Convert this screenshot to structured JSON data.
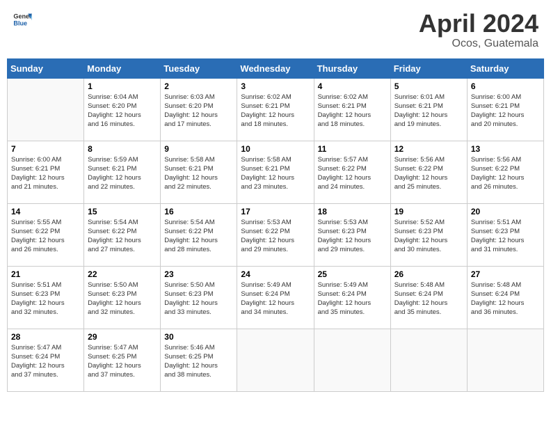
{
  "header": {
    "logo_general": "General",
    "logo_blue": "Blue",
    "month": "April 2024",
    "location": "Ocos, Guatemala"
  },
  "columns": [
    "Sunday",
    "Monday",
    "Tuesday",
    "Wednesday",
    "Thursday",
    "Friday",
    "Saturday"
  ],
  "weeks": [
    [
      {
        "day": "",
        "info": ""
      },
      {
        "day": "1",
        "info": "Sunrise: 6:04 AM\nSunset: 6:20 PM\nDaylight: 12 hours\nand 16 minutes."
      },
      {
        "day": "2",
        "info": "Sunrise: 6:03 AM\nSunset: 6:20 PM\nDaylight: 12 hours\nand 17 minutes."
      },
      {
        "day": "3",
        "info": "Sunrise: 6:02 AM\nSunset: 6:21 PM\nDaylight: 12 hours\nand 18 minutes."
      },
      {
        "day": "4",
        "info": "Sunrise: 6:02 AM\nSunset: 6:21 PM\nDaylight: 12 hours\nand 18 minutes."
      },
      {
        "day": "5",
        "info": "Sunrise: 6:01 AM\nSunset: 6:21 PM\nDaylight: 12 hours\nand 19 minutes."
      },
      {
        "day": "6",
        "info": "Sunrise: 6:00 AM\nSunset: 6:21 PM\nDaylight: 12 hours\nand 20 minutes."
      }
    ],
    [
      {
        "day": "7",
        "info": "Sunrise: 6:00 AM\nSunset: 6:21 PM\nDaylight: 12 hours\nand 21 minutes."
      },
      {
        "day": "8",
        "info": "Sunrise: 5:59 AM\nSunset: 6:21 PM\nDaylight: 12 hours\nand 22 minutes."
      },
      {
        "day": "9",
        "info": "Sunrise: 5:58 AM\nSunset: 6:21 PM\nDaylight: 12 hours\nand 22 minutes."
      },
      {
        "day": "10",
        "info": "Sunrise: 5:58 AM\nSunset: 6:21 PM\nDaylight: 12 hours\nand 23 minutes."
      },
      {
        "day": "11",
        "info": "Sunrise: 5:57 AM\nSunset: 6:22 PM\nDaylight: 12 hours\nand 24 minutes."
      },
      {
        "day": "12",
        "info": "Sunrise: 5:56 AM\nSunset: 6:22 PM\nDaylight: 12 hours\nand 25 minutes."
      },
      {
        "day": "13",
        "info": "Sunrise: 5:56 AM\nSunset: 6:22 PM\nDaylight: 12 hours\nand 26 minutes."
      }
    ],
    [
      {
        "day": "14",
        "info": "Sunrise: 5:55 AM\nSunset: 6:22 PM\nDaylight: 12 hours\nand 26 minutes."
      },
      {
        "day": "15",
        "info": "Sunrise: 5:54 AM\nSunset: 6:22 PM\nDaylight: 12 hours\nand 27 minutes."
      },
      {
        "day": "16",
        "info": "Sunrise: 5:54 AM\nSunset: 6:22 PM\nDaylight: 12 hours\nand 28 minutes."
      },
      {
        "day": "17",
        "info": "Sunrise: 5:53 AM\nSunset: 6:22 PM\nDaylight: 12 hours\nand 29 minutes."
      },
      {
        "day": "18",
        "info": "Sunrise: 5:53 AM\nSunset: 6:23 PM\nDaylight: 12 hours\nand 29 minutes."
      },
      {
        "day": "19",
        "info": "Sunrise: 5:52 AM\nSunset: 6:23 PM\nDaylight: 12 hours\nand 30 minutes."
      },
      {
        "day": "20",
        "info": "Sunrise: 5:51 AM\nSunset: 6:23 PM\nDaylight: 12 hours\nand 31 minutes."
      }
    ],
    [
      {
        "day": "21",
        "info": "Sunrise: 5:51 AM\nSunset: 6:23 PM\nDaylight: 12 hours\nand 32 minutes."
      },
      {
        "day": "22",
        "info": "Sunrise: 5:50 AM\nSunset: 6:23 PM\nDaylight: 12 hours\nand 32 minutes."
      },
      {
        "day": "23",
        "info": "Sunrise: 5:50 AM\nSunset: 6:23 PM\nDaylight: 12 hours\nand 33 minutes."
      },
      {
        "day": "24",
        "info": "Sunrise: 5:49 AM\nSunset: 6:24 PM\nDaylight: 12 hours\nand 34 minutes."
      },
      {
        "day": "25",
        "info": "Sunrise: 5:49 AM\nSunset: 6:24 PM\nDaylight: 12 hours\nand 35 minutes."
      },
      {
        "day": "26",
        "info": "Sunrise: 5:48 AM\nSunset: 6:24 PM\nDaylight: 12 hours\nand 35 minutes."
      },
      {
        "day": "27",
        "info": "Sunrise: 5:48 AM\nSunset: 6:24 PM\nDaylight: 12 hours\nand 36 minutes."
      }
    ],
    [
      {
        "day": "28",
        "info": "Sunrise: 5:47 AM\nSunset: 6:24 PM\nDaylight: 12 hours\nand 37 minutes."
      },
      {
        "day": "29",
        "info": "Sunrise: 5:47 AM\nSunset: 6:25 PM\nDaylight: 12 hours\nand 37 minutes."
      },
      {
        "day": "30",
        "info": "Sunrise: 5:46 AM\nSunset: 6:25 PM\nDaylight: 12 hours\nand 38 minutes."
      },
      {
        "day": "",
        "info": ""
      },
      {
        "day": "",
        "info": ""
      },
      {
        "day": "",
        "info": ""
      },
      {
        "day": "",
        "info": ""
      }
    ]
  ]
}
